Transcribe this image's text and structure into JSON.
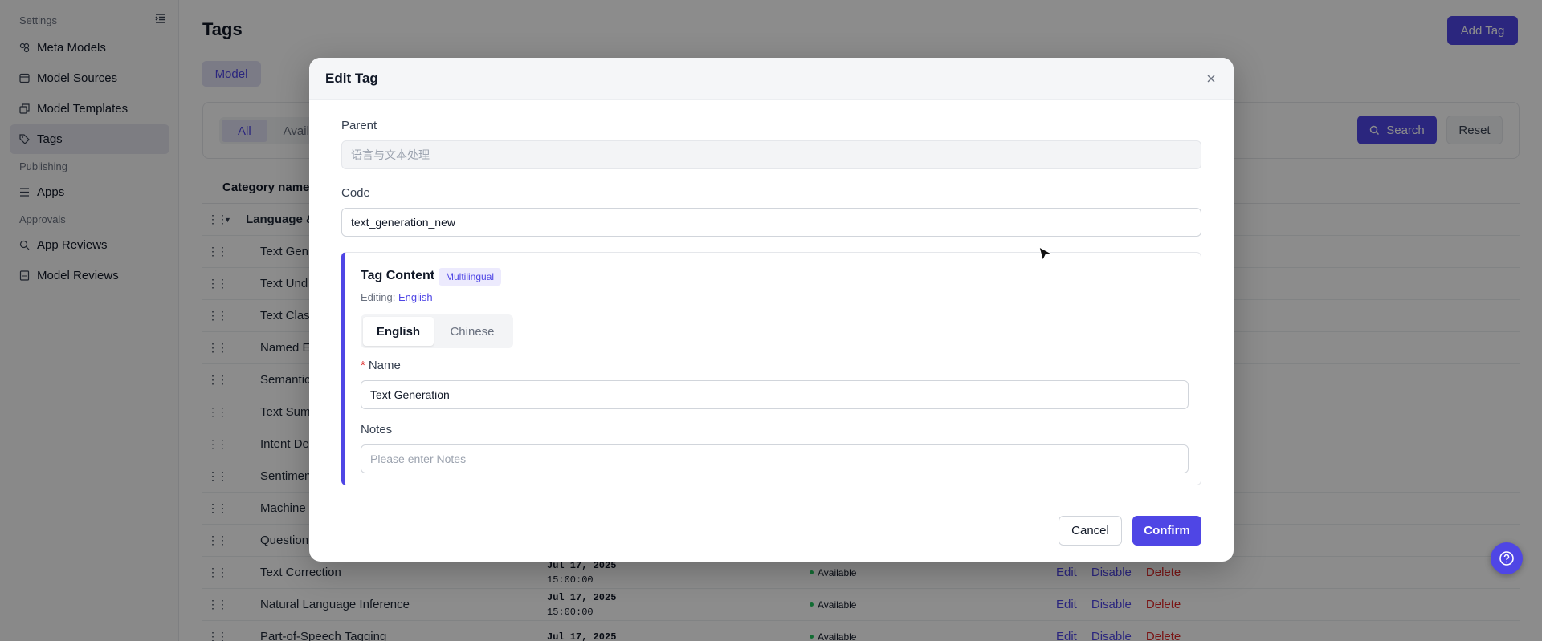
{
  "sidebar": {
    "groups": [
      {
        "label": "Settings"
      },
      {
        "label": "Publishing"
      },
      {
        "label": "Approvals"
      }
    ],
    "items": [
      {
        "label": "Meta Models",
        "icon": "meta-models-icon"
      },
      {
        "label": "Model Sources",
        "icon": "model-sources-icon"
      },
      {
        "label": "Model Templates",
        "icon": "model-templates-icon"
      },
      {
        "label": "Tags",
        "icon": "tag-icon",
        "active": true
      },
      {
        "label": "Apps",
        "icon": "apps-icon"
      },
      {
        "label": "App Reviews",
        "icon": "app-reviews-icon"
      },
      {
        "label": "Model Reviews",
        "icon": "model-reviews-icon"
      }
    ]
  },
  "header": {
    "title": "Tags",
    "add_button": "Add Tag",
    "tab": "Model"
  },
  "filters": {
    "segments": [
      "All",
      "Avail"
    ],
    "search_label": "Search",
    "reset_label": "Reset"
  },
  "table": {
    "column_header": "Category name",
    "parent_row": "Language &",
    "rows": [
      {
        "name": "Text Gen"
      },
      {
        "name": "Text Und"
      },
      {
        "name": "Text Clas"
      },
      {
        "name": "Named E"
      },
      {
        "name": "Semantic"
      },
      {
        "name": "Text Sum"
      },
      {
        "name": "Intent De"
      },
      {
        "name": "Sentimen"
      },
      {
        "name": "Machine"
      },
      {
        "name": "Question"
      },
      {
        "name": "Text Correction",
        "date": "Jul 17, 2025",
        "time": "15:00:00",
        "status": "Available",
        "edit": "Edit",
        "disable": "Disable",
        "delete": "Delete"
      },
      {
        "name": "Natural Language Inference",
        "date": "Jul 17, 2025",
        "time": "15:00:00",
        "status": "Available",
        "edit": "Edit",
        "disable": "Disable",
        "delete": "Delete"
      },
      {
        "name": "Part-of-Speech Tagging",
        "date": "Jul 17, 2025",
        "time": "",
        "status": "Available",
        "edit": "Edit",
        "disable": "Disable",
        "delete": "Delete"
      }
    ]
  },
  "modal": {
    "title": "Edit Tag",
    "parent_label": "Parent",
    "parent_value": "语言与文本处理",
    "code_label": "Code",
    "code_value": "text_generation_new",
    "content_title": "Tag Content",
    "badge": "Multilingual",
    "editing_prefix": "Editing:",
    "editing_lang": "English",
    "languages": [
      "English",
      "Chinese"
    ],
    "name_label": "Name",
    "name_required": "*",
    "name_value": "Text Generation",
    "notes_label": "Notes",
    "notes_placeholder": "Please enter Notes",
    "cancel": "Cancel",
    "confirm": "Confirm"
  },
  "colors": {
    "accent": "#4f46e5",
    "danger": "#dc2626",
    "success": "#22c55e"
  }
}
